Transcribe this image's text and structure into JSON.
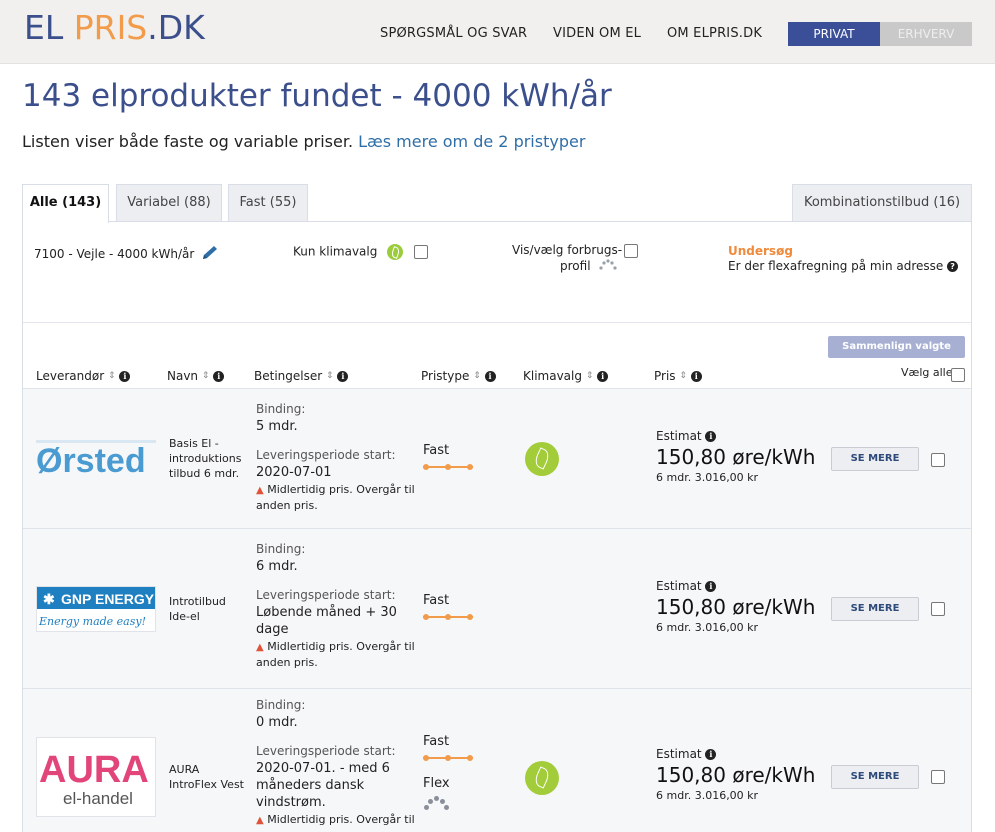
{
  "brand": {
    "part1": "EL ",
    "part2": "PRIS",
    "part3": ".DK"
  },
  "nav": {
    "faq": "SPØRGSMÅL OG SVAR",
    "knowledge": "VIDEN OM EL",
    "about": "OM ELPRIS.DK",
    "private": "PRIVAT",
    "business": "ERHVERV"
  },
  "title": "143 elprodukter fundet - 4000 kWh/år",
  "intro": {
    "text": "Listen viser både faste og variable priser. ",
    "link": "Læs mere om de 2 pristyper"
  },
  "tabs": {
    "all": "Alle (143)",
    "variable": "Variabel (88)",
    "fixed": "Fast (55)",
    "combo": "Kombinationstilbud (16)"
  },
  "filters": {
    "location": "7100 - Vejle - 4000 kWh/år",
    "climate": "Kun klimavalg",
    "profile_line1": "Vis/vælg forbrugs-",
    "profile_line2": "profil",
    "investigate": "Undersøg",
    "flex_question": "Er der flexafregning på min adresse"
  },
  "compare_button": "Sammenlign valgte",
  "columns": {
    "supplier": "Leverandør",
    "name": "Navn",
    "terms": "Betingelser",
    "pricetype": "Pristype",
    "climate": "Klimavalg",
    "price": "Pris",
    "select_all": "Vælg alle"
  },
  "rows": [
    {
      "supplier": "Ørsted",
      "name_lines": [
        "Basis El -",
        "introduktions",
        "tilbud 6 mdr."
      ],
      "binding_label": "Binding:",
      "binding": "5 mdr.",
      "period_label": "Leveringsperiode start:",
      "period": [
        "2020-07-01"
      ],
      "warning": [
        "Midlertidig pris. Overgår til",
        "anden pris."
      ],
      "pricetypes": [
        "Fast"
      ],
      "estimate_label": "Estimat",
      "price": "150,80 øre/kWh",
      "sub_price": "6 mdr. 3.016,00 kr",
      "button": "SE MERE"
    },
    {
      "supplier": "GNP ENERGY",
      "supplier_tagline": "Energy made easy!",
      "name_lines": [
        "Introtilbud",
        "Ide-el"
      ],
      "binding_label": "Binding:",
      "binding": "6 mdr.",
      "period_label": "Leveringsperiode start:",
      "period": [
        "Løbende måned + 30",
        "dage"
      ],
      "warning": [
        "Midlertidig pris. Overgår til",
        "anden pris."
      ],
      "pricetypes": [
        "Fast"
      ],
      "estimate_label": "Estimat",
      "price": "150,80 øre/kWh",
      "sub_price": "6 mdr. 3.016,00 kr",
      "button": "SE MERE"
    },
    {
      "supplier": "AURA",
      "supplier_tagline": "el-handel",
      "name_lines": [
        "AURA",
        "IntroFlex Vest"
      ],
      "binding_label": "Binding:",
      "binding": "0 mdr.",
      "period_label": "Leveringsperiode start:",
      "period": [
        "2020-07-01. - med 6",
        "måneders dansk",
        "vindstrøm."
      ],
      "warning": [
        "Midlertidig pris. Overgår til"
      ],
      "pricetypes": [
        "Fast",
        "Flex"
      ],
      "estimate_label": "Estimat",
      "price": "150,80 øre/kWh",
      "sub_price": "6 mdr. 3.016,00 kr",
      "button": "SE MERE"
    }
  ],
  "colors": {
    "brand_blue": "#3b4f8c",
    "brand_orange": "#f29c4b",
    "leaf_green": "#a3cc3a",
    "link_blue": "#2f6ea7"
  }
}
